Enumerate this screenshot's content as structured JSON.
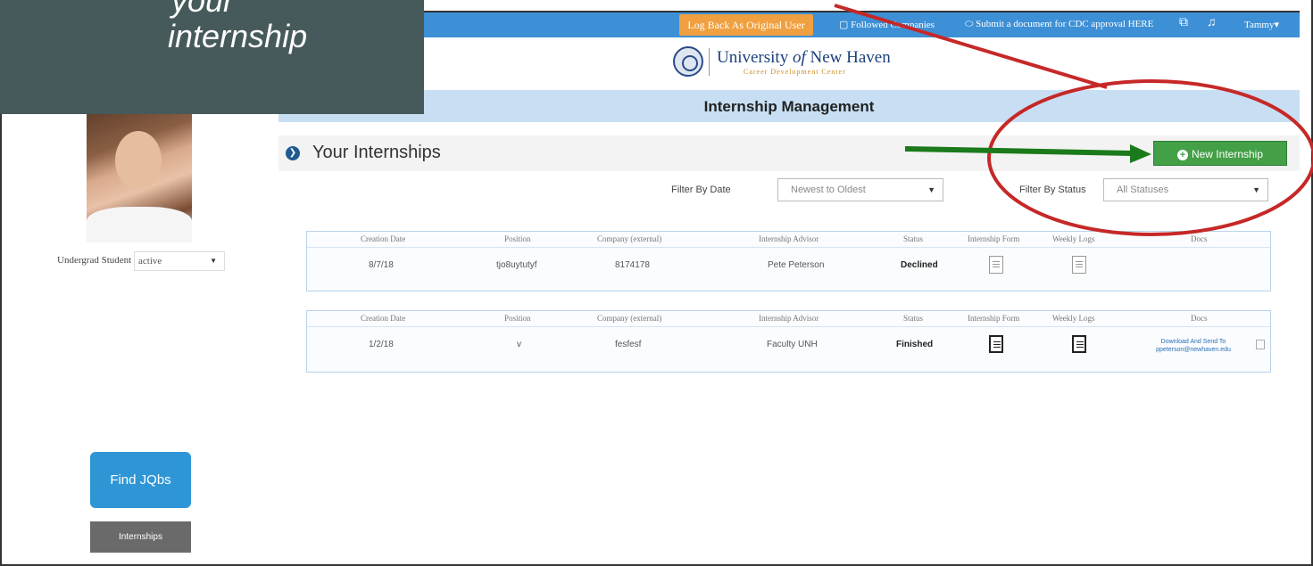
{
  "caption": {
    "line1": "your",
    "line2": "internship"
  },
  "topbar": {
    "log_back": "Log Back As Original User",
    "followed_companies": "Followed Companies",
    "submit_doc": "Submit a document for CDC approval HERE",
    "user": "Tammy"
  },
  "logo": {
    "name_prefix": "University ",
    "name_of": "of",
    "name_suffix": " New Haven",
    "sub": "Career Development Center"
  },
  "management_title": "Internship Management",
  "section": {
    "title": "Your Internships",
    "new_button": "New Internship"
  },
  "filters": {
    "date_label": "Filter By Date",
    "date_value": "Newest to Oldest",
    "status_label": "Filter By Status",
    "status_value": "All Statuses"
  },
  "table_headers": [
    "Creation Date",
    "Position",
    "Company (external)",
    "Internship Advisor",
    "Status",
    "Internship Form",
    "Weekly Logs",
    "Docs"
  ],
  "internships": [
    {
      "creation_date": "8/7/18",
      "position": "tjo8uytutyf",
      "company": "8174178",
      "advisor": "Pete Peterson",
      "status": "Declined",
      "docs": ""
    },
    {
      "creation_date": "1/2/18",
      "position": "v",
      "company": "fesfesf",
      "advisor": "Faculty UNH",
      "status": "Finished",
      "docs": "Download And Send To ppeterson@newhaven.edu"
    }
  ],
  "profile": {
    "role": "Undergrad Student",
    "status": "active"
  },
  "sidebar": {
    "find_jobs": "Find JQbs",
    "internships": "Internships"
  },
  "colors": {
    "topbar": "#3e90d6",
    "new_button": "#43a047",
    "annotation_red": "#c62828",
    "annotation_green": "#1b7a1b"
  }
}
